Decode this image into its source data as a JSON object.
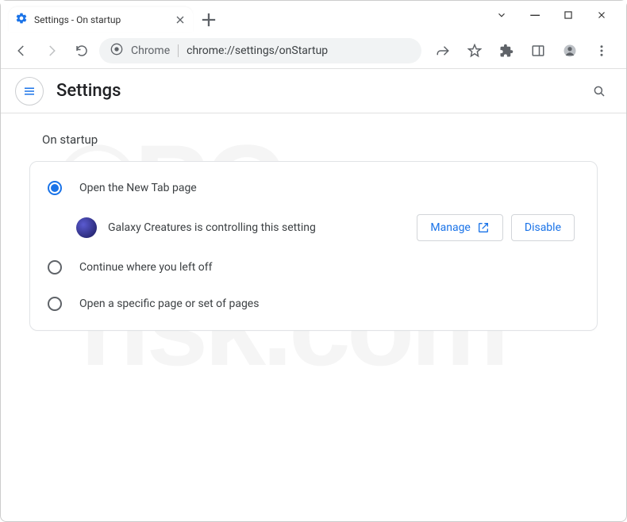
{
  "tab": {
    "title": "Settings - On startup"
  },
  "url": {
    "prefix": "Chrome",
    "path": "chrome://settings/onStartup"
  },
  "header": {
    "title": "Settings"
  },
  "section": {
    "label": "On startup"
  },
  "options": {
    "open_new_tab": "Open the New Tab page",
    "continue": "Continue where you left off",
    "specific": "Open a specific page or set of pages"
  },
  "extension": {
    "message": "Galaxy Creatures is controlling this setting",
    "manage_label": "Manage",
    "disable_label": "Disable"
  },
  "watermark": {
    "line1": "©PC",
    "line2": "risk.com"
  }
}
